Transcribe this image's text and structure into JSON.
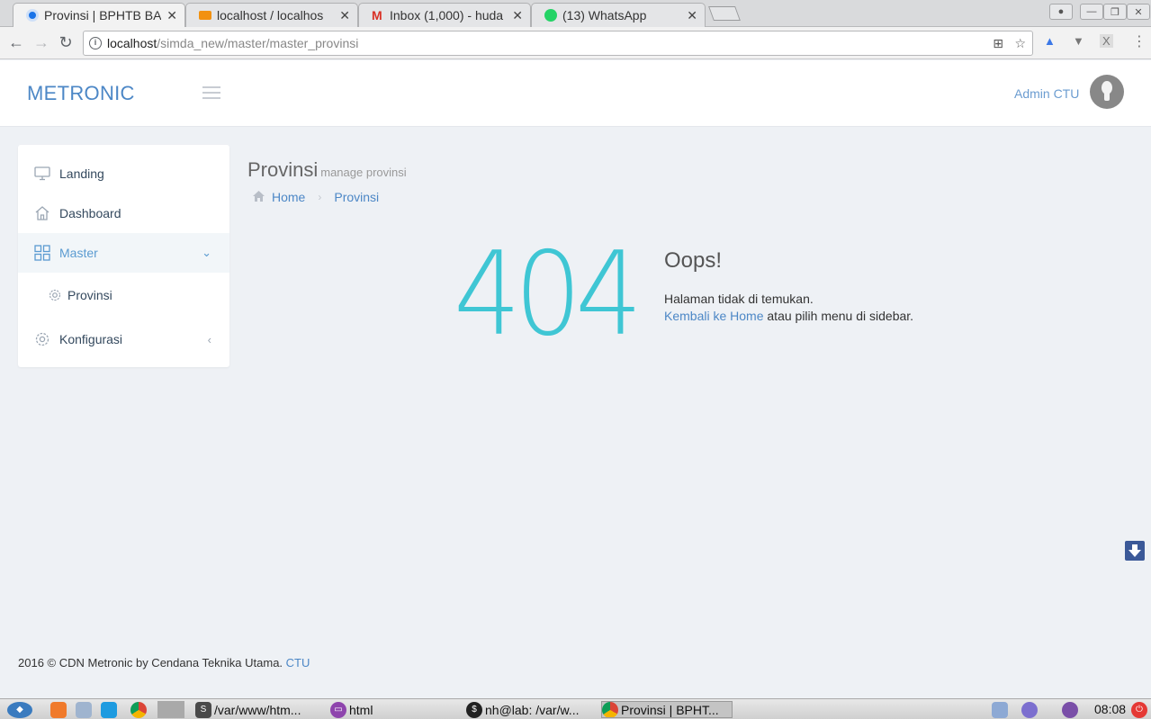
{
  "browser": {
    "tabs": [
      {
        "title": "Provinsi | BPHTB BA",
        "favicon_color": "#1a73e8"
      },
      {
        "title": "localhost / localhos",
        "favicon_color": "#f29111"
      },
      {
        "title": "Inbox (1,000) - huda",
        "favicon_color": "#d93025"
      },
      {
        "title": "(13) WhatsApp",
        "favicon_color": "#25d366"
      }
    ],
    "close_glyph": "✕",
    "url_host": "localhost",
    "url_path": "/simda_new/master/master_provinsi"
  },
  "header": {
    "logo": "METRONIC",
    "user_name": "Admin CTU"
  },
  "sidebar": {
    "items": [
      {
        "label": "Landing",
        "icon": "monitor-icon"
      },
      {
        "label": "Dashboard",
        "icon": "home-icon"
      },
      {
        "label": "Master",
        "icon": "grid-icon",
        "arrow": "⌄"
      },
      {
        "label": "Provinsi",
        "icon": "gear-icon"
      },
      {
        "label": "Konfigurasi",
        "icon": "gear-icon",
        "arrow": "‹"
      }
    ]
  },
  "page": {
    "title": "Provinsi",
    "subtitle": "manage provinsi",
    "breadcrumb": [
      "Home",
      "Provinsi"
    ]
  },
  "error": {
    "code": "404",
    "title": "Oops!",
    "message": "Halaman tidak di temukan.",
    "link_text": "Kembali ke Home",
    "after_link": " atau pilih menu di sidebar."
  },
  "footer": {
    "text": "2016 © CDN Metronic by Cendana Teknika Utama. ",
    "link": "CTU"
  },
  "taskbar": {
    "items": [
      "/var/www/htm...",
      "html",
      "nh@lab: /var/w...",
      "Provinsi | BPHT..."
    ],
    "clock": "08:08"
  },
  "colors": {
    "accent": "#4c87c6",
    "error_code": "#3fc6d4",
    "sidebar_active_bg": "#f2f6f9"
  }
}
